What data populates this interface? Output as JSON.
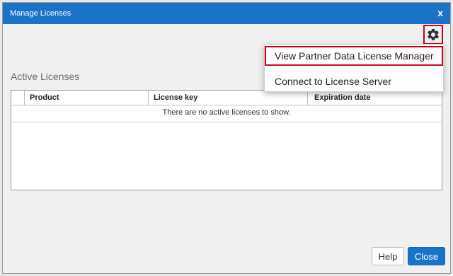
{
  "dialog": {
    "title": "Manage Licenses",
    "close_glyph": "x"
  },
  "settings": {
    "icon": "gear-icon",
    "menu": [
      {
        "label": "View Partner Data License Manager",
        "highlighted": true
      },
      {
        "label": "Connect to License Server",
        "highlighted": false
      }
    ]
  },
  "licenses": {
    "section_title": "Active Licenses",
    "columns": [
      "Product",
      "License key",
      "Expiration date"
    ],
    "empty_message": "There are no active licenses to show."
  },
  "footer": {
    "help_label": "Help",
    "close_label": "Close"
  },
  "colors": {
    "accent": "#1b73c8",
    "highlight_border": "#d0021b"
  }
}
